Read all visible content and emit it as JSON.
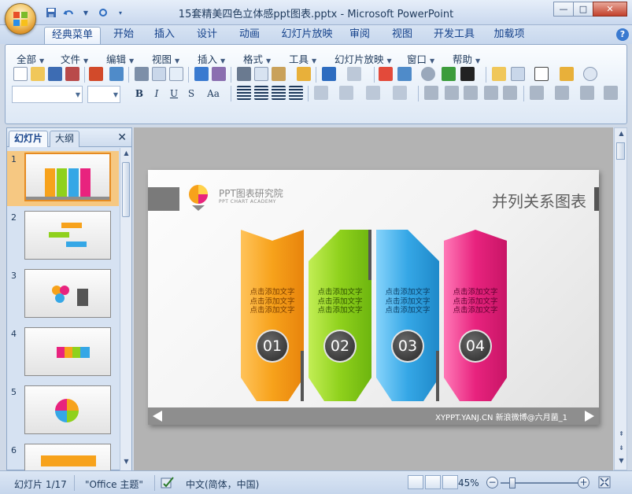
{
  "window": {
    "title": "15套精美四色立体感ppt图表.pptx - Microsoft PowerPoint",
    "minimize": "—",
    "maximize": "□",
    "close": "✕"
  },
  "ribbon_tabs": [
    {
      "label": "经典菜单",
      "active": true
    },
    {
      "label": "开始"
    },
    {
      "label": "插入"
    },
    {
      "label": "设计"
    },
    {
      "label": "动画"
    },
    {
      "label": "幻灯片放映"
    },
    {
      "label": "审阅"
    },
    {
      "label": "视图"
    },
    {
      "label": "开发工具"
    },
    {
      "label": "加载项"
    }
  ],
  "help_icon": "?",
  "classic_menu": [
    "全部",
    "文件",
    "编辑",
    "视图",
    "插入",
    "格式",
    "工具",
    "幻灯片放映",
    "窗口",
    "帮助"
  ],
  "format_buttons": [
    "B",
    "I",
    "U",
    "S",
    "Aa"
  ],
  "left_panel": {
    "tabs": [
      "幻灯片",
      "大纲"
    ],
    "close": "✕",
    "slides": [
      {
        "num": "1",
        "active": true
      },
      {
        "num": "2"
      },
      {
        "num": "3"
      },
      {
        "num": "4"
      },
      {
        "num": "5"
      },
      {
        "num": "6"
      }
    ]
  },
  "slide": {
    "brand_cn": "PPT图表研究院",
    "brand_en": "PPT CHART ACADEMY",
    "title": "并列关系图表",
    "columns": [
      {
        "number": "01",
        "color": "#f7a21b",
        "light": "#ffc35a",
        "text": [
          "点击添加文字",
          "点击添加文字",
          "点击添加文字"
        ]
      },
      {
        "number": "02",
        "color": "#8fd11c",
        "light": "#c2ee55",
        "text": [
          "点击添加文字",
          "点击添加文字",
          "点击添加文字"
        ]
      },
      {
        "number": "03",
        "color": "#35a7e6",
        "light": "#86d3fb",
        "text": [
          "点击添加文字",
          "点击添加文字",
          "点击添加文字"
        ]
      },
      {
        "number": "04",
        "color": "#e8237e",
        "light": "#ff79b7",
        "text": [
          "点击添加文字",
          "点击添加文字",
          "点击添加文字"
        ]
      }
    ],
    "footer": "XYPPT.YANJ.CN  新浪微博@六月菌_1"
  },
  "statusbar": {
    "slide_indicator": "幻灯片 1/17",
    "theme": "\"Office 主题\"",
    "language": "中文(简体，中国)",
    "zoom": "45%",
    "zoom_level_fraction": 0.45
  },
  "colors": {
    "accent_orange": "#e58b22",
    "ribbon_blue": "#15428b"
  }
}
